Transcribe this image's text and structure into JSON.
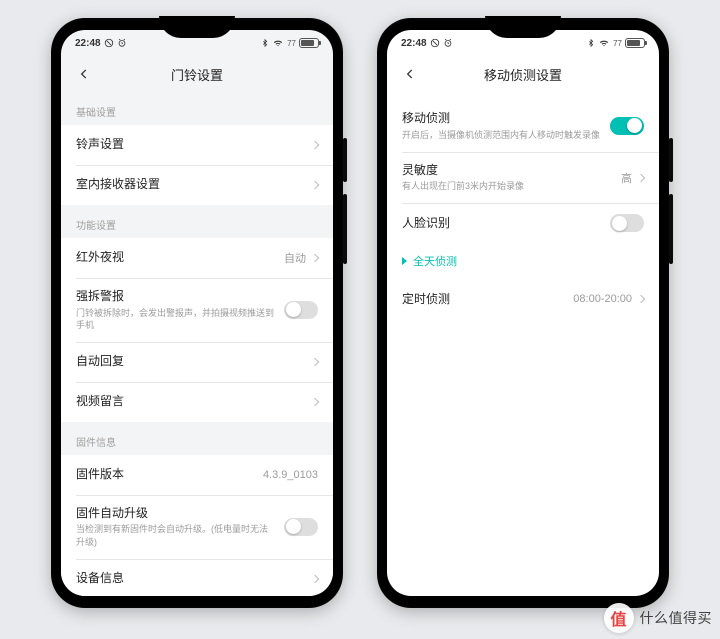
{
  "status": {
    "time": "22:48",
    "battery_pct": "77"
  },
  "left": {
    "title": "门铃设置",
    "sections": [
      {
        "header": "基础设置",
        "rows": [
          {
            "label": "铃声设置",
            "type": "nav"
          },
          {
            "label": "室内接收器设置",
            "type": "nav"
          }
        ]
      },
      {
        "header": "功能设置",
        "rows": [
          {
            "label": "红外夜视",
            "type": "value",
            "value": "自动"
          },
          {
            "label": "强拆警报",
            "sub": "门铃被拆除时，会发出警报声，并拍摄视频推送到手机",
            "type": "toggle",
            "on": false
          },
          {
            "label": "自动回复",
            "type": "nav"
          },
          {
            "label": "视频留言",
            "type": "nav"
          }
        ]
      },
      {
        "header": "固件信息",
        "rows": [
          {
            "label": "固件版本",
            "type": "value-plain",
            "value": "4.3.9_0103"
          },
          {
            "label": "固件自动升级",
            "sub": "当检测到有新固件时会自动升级。(低电量时无法升级)",
            "type": "toggle",
            "on": false
          },
          {
            "label": "设备信息",
            "type": "nav"
          }
        ]
      }
    ]
  },
  "right": {
    "title": "移动侦测设置",
    "rows": [
      {
        "label": "移动侦测",
        "sub": "开启后，当摄像机侦测范围内有人移动时触发录像",
        "type": "toggle",
        "on": true
      },
      {
        "label": "灵敏度",
        "sub": "有人出现在门前3米内开始录像",
        "type": "value",
        "value": "高"
      },
      {
        "label": "人脸识别",
        "type": "toggle",
        "on": false
      }
    ],
    "active_tab": "全天侦测",
    "schedule": {
      "label": "定时侦测",
      "value": "08:00-20:00"
    }
  },
  "watermark": {
    "badge": "值",
    "text": "什么值得买"
  }
}
